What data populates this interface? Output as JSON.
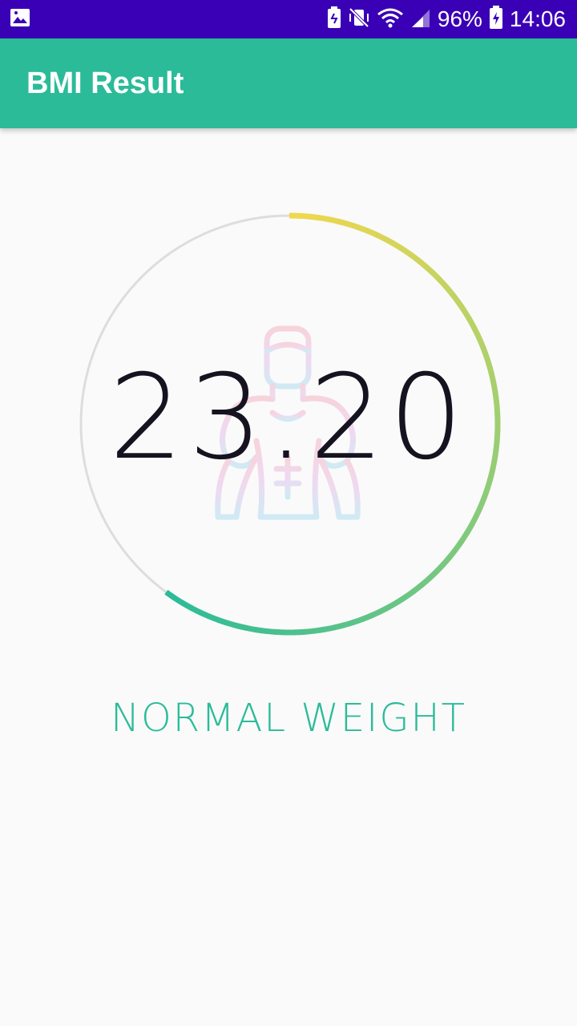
{
  "status_bar": {
    "battery_percent": "96%",
    "time": "14:06",
    "icons": [
      "image-icon",
      "battery-saver-icon",
      "vibrate-off-icon",
      "wifi-icon",
      "signal-icon",
      "battery-charging-icon"
    ]
  },
  "app_bar": {
    "title": "BMI Result"
  },
  "result": {
    "bmi_value": "23.20",
    "category": "NORMAL WEIGHT",
    "gauge_fill_fraction": 0.6,
    "colors": {
      "gauge_track": "#dddddd",
      "gauge_start": "#f0d84e",
      "gauge_mid": "#8fcc78",
      "gauge_end": "#2bbb99",
      "category_text": "#2bbb99"
    },
    "illustration": "muscular-man-icon"
  }
}
